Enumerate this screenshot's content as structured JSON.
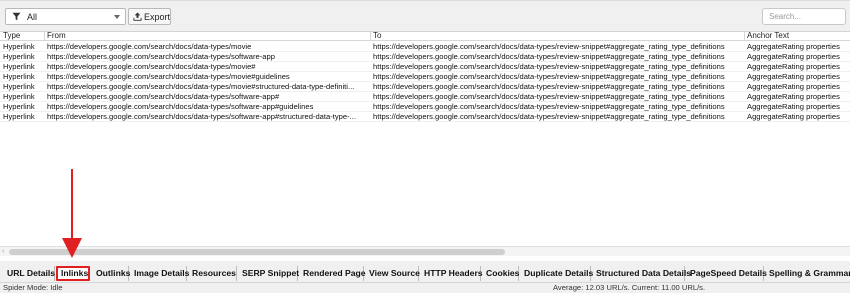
{
  "toolbar": {
    "filter_value": "All",
    "export_label": "Export",
    "search_placeholder": "Search..."
  },
  "table": {
    "columns": [
      "Type",
      "From",
      "To",
      "Anchor Text"
    ],
    "rows": [
      [
        "Hyperlink",
        "https://developers.google.com/search/docs/data-types/movie",
        "https://developers.google.com/search/docs/data-types/review-snippet#aggregate_rating_type_definitions",
        "AggregateRating properties"
      ],
      [
        "Hyperlink",
        "https://developers.google.com/search/docs/data-types/software-app",
        "https://developers.google.com/search/docs/data-types/review-snippet#aggregate_rating_type_definitions",
        "AggregateRating properties"
      ],
      [
        "Hyperlink",
        "https://developers.google.com/search/docs/data-types/movie#",
        "https://developers.google.com/search/docs/data-types/review-snippet#aggregate_rating_type_definitions",
        "AggregateRating properties"
      ],
      [
        "Hyperlink",
        "https://developers.google.com/search/docs/data-types/movie#guidelines",
        "https://developers.google.com/search/docs/data-types/review-snippet#aggregate_rating_type_definitions",
        "AggregateRating properties"
      ],
      [
        "Hyperlink",
        "https://developers.google.com/search/docs/data-types/movie#structured-data-type-definiti...",
        "https://developers.google.com/search/docs/data-types/review-snippet#aggregate_rating_type_definitions",
        "AggregateRating properties"
      ],
      [
        "Hyperlink",
        "https://developers.google.com/search/docs/data-types/software-app#",
        "https://developers.google.com/search/docs/data-types/review-snippet#aggregate_rating_type_definitions",
        "AggregateRating properties"
      ],
      [
        "Hyperlink",
        "https://developers.google.com/search/docs/data-types/software-app#guidelines",
        "https://developers.google.com/search/docs/data-types/review-snippet#aggregate_rating_type_definitions",
        "AggregateRating properties"
      ],
      [
        "Hyperlink",
        "https://developers.google.com/search/docs/data-types/software-app#structured-data-type-...",
        "https://developers.google.com/search/docs/data-types/review-snippet#aggregate_rating_type_definitions",
        "AggregateRating properties"
      ]
    ]
  },
  "tabs": [
    {
      "label": "URL Details",
      "selected": false
    },
    {
      "label": "Inlinks",
      "selected": true
    },
    {
      "label": "Outlinks",
      "selected": false
    },
    {
      "label": "Image Details",
      "selected": false
    },
    {
      "label": "Resources",
      "selected": false
    },
    {
      "label": "SERP Snippet",
      "selected": false
    },
    {
      "label": "Rendered Page",
      "selected": false
    },
    {
      "label": "View Source",
      "selected": false
    },
    {
      "label": "HTTP Headers",
      "selected": false
    },
    {
      "label": "Cookies",
      "selected": false
    },
    {
      "label": "Duplicate Details",
      "selected": false
    },
    {
      "label": "Structured Data Details",
      "selected": false
    },
    {
      "label": "PageSpeed Details",
      "selected": false
    },
    {
      "label": "Spelling & Grammar D",
      "selected": false
    }
  ],
  "status": {
    "mode": "Spider Mode: Idle",
    "speed": "Average: 12.03 URL/s. Current: 11.00 URL/s."
  },
  "colors": {
    "highlight": "#e02020",
    "background": "#f0f0f0"
  },
  "icons": {
    "filter": "funnel-icon",
    "export": "export-upload-icon"
  }
}
